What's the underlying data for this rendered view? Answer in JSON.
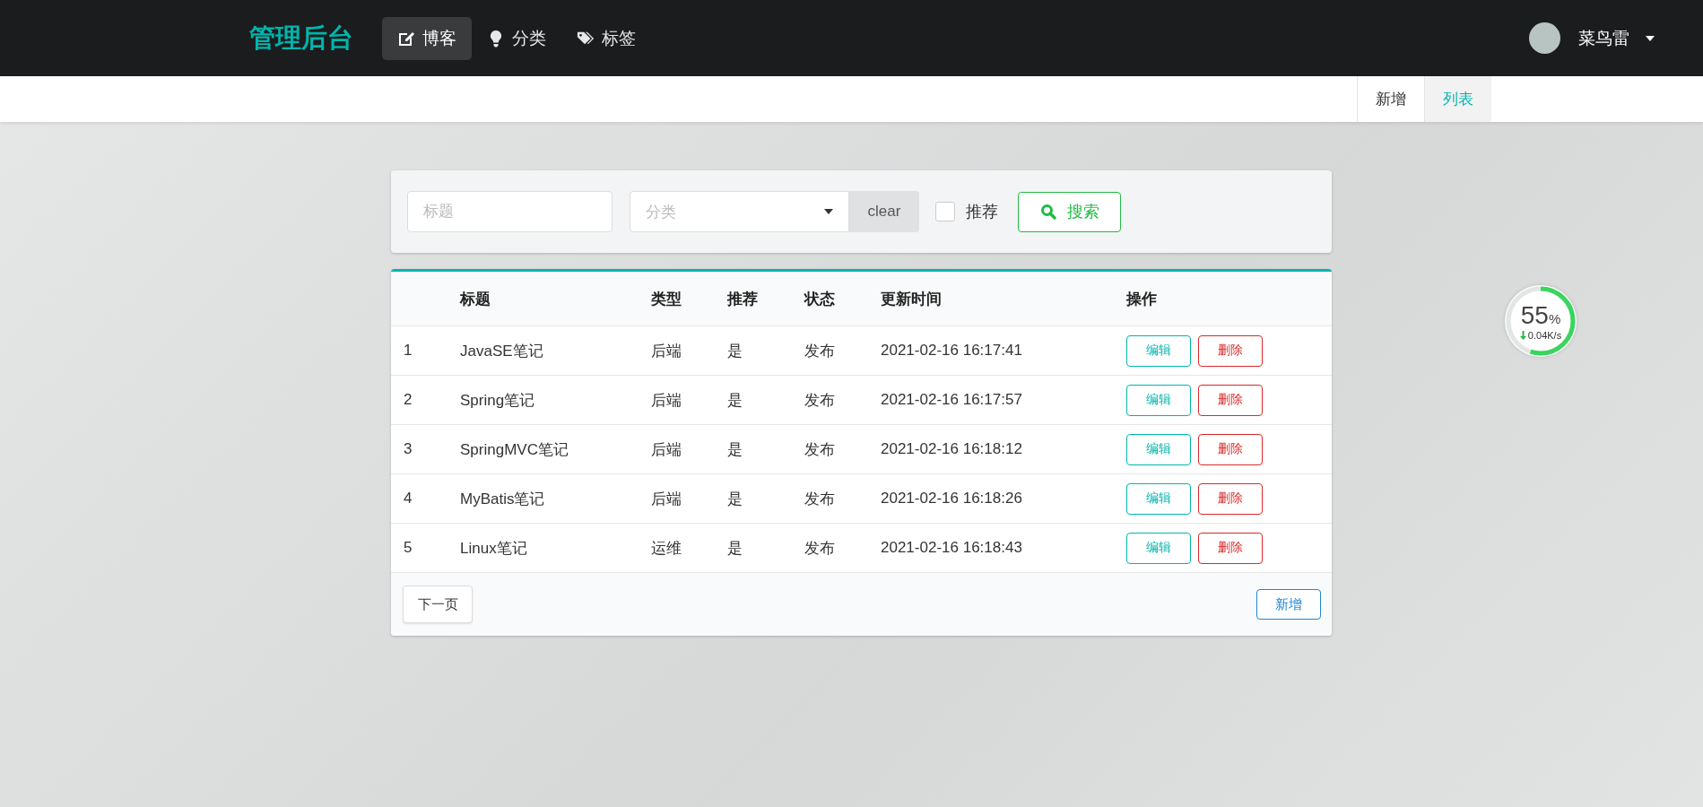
{
  "navbar": {
    "logo": "管理后台",
    "menu": [
      {
        "label": "博客",
        "kind": "edit",
        "selected": true
      },
      {
        "label": "分类",
        "kind": "lightbulb",
        "selected": false
      },
      {
        "label": "标签",
        "kind": "tags",
        "selected": false
      }
    ],
    "user": {
      "name": "菜鸟雷"
    }
  },
  "submenu": [
    {
      "label": "新增",
      "selected": false
    },
    {
      "label": "列表",
      "selected": true
    }
  ],
  "search": {
    "title_placeholder": "标题",
    "category_placeholder": "分类",
    "clear": "clear",
    "recommend": {
      "label": "推荐",
      "checked": false
    },
    "search_button": "搜索"
  },
  "table": {
    "columns": [
      "标题",
      "类型",
      "推荐",
      "状态",
      "更新时间",
      "操作"
    ],
    "rows": [
      {
        "index": "1",
        "title": "JavaSE笔记",
        "type": "后端",
        "recommended": "是",
        "status": "发布",
        "updated": "2021-02-16 16:17:41",
        "actions": [
          "编辑",
          "删除"
        ]
      },
      {
        "index": "2",
        "title": "Spring笔记",
        "type": "后端",
        "recommended": "是",
        "status": "发布",
        "updated": "2021-02-16 16:17:57",
        "actions": [
          "编辑",
          "删除"
        ]
      },
      {
        "index": "3",
        "title": "SpringMVC笔记",
        "type": "后端",
        "recommended": "是",
        "status": "发布",
        "updated": "2021-02-16 16:18:12",
        "actions": [
          "编辑",
          "删除"
        ]
      },
      {
        "index": "4",
        "title": "MyBatis笔记",
        "type": "后端",
        "recommended": "是",
        "status": "发布",
        "updated": "2021-02-16 16:18:26",
        "actions": [
          "编辑",
          "删除"
        ]
      },
      {
        "index": "5",
        "title": "Linux笔记",
        "type": "运维",
        "recommended": "是",
        "status": "发布",
        "updated": "2021-02-16 16:18:43",
        "actions": [
          "编辑",
          "删除"
        ]
      }
    ],
    "footer": {
      "next_page": "下一页",
      "add": "新增"
    }
  },
  "speed_widget": {
    "level": 0.55,
    "percent": "55",
    "unit": "%",
    "speed": "0.04K/s"
  }
}
